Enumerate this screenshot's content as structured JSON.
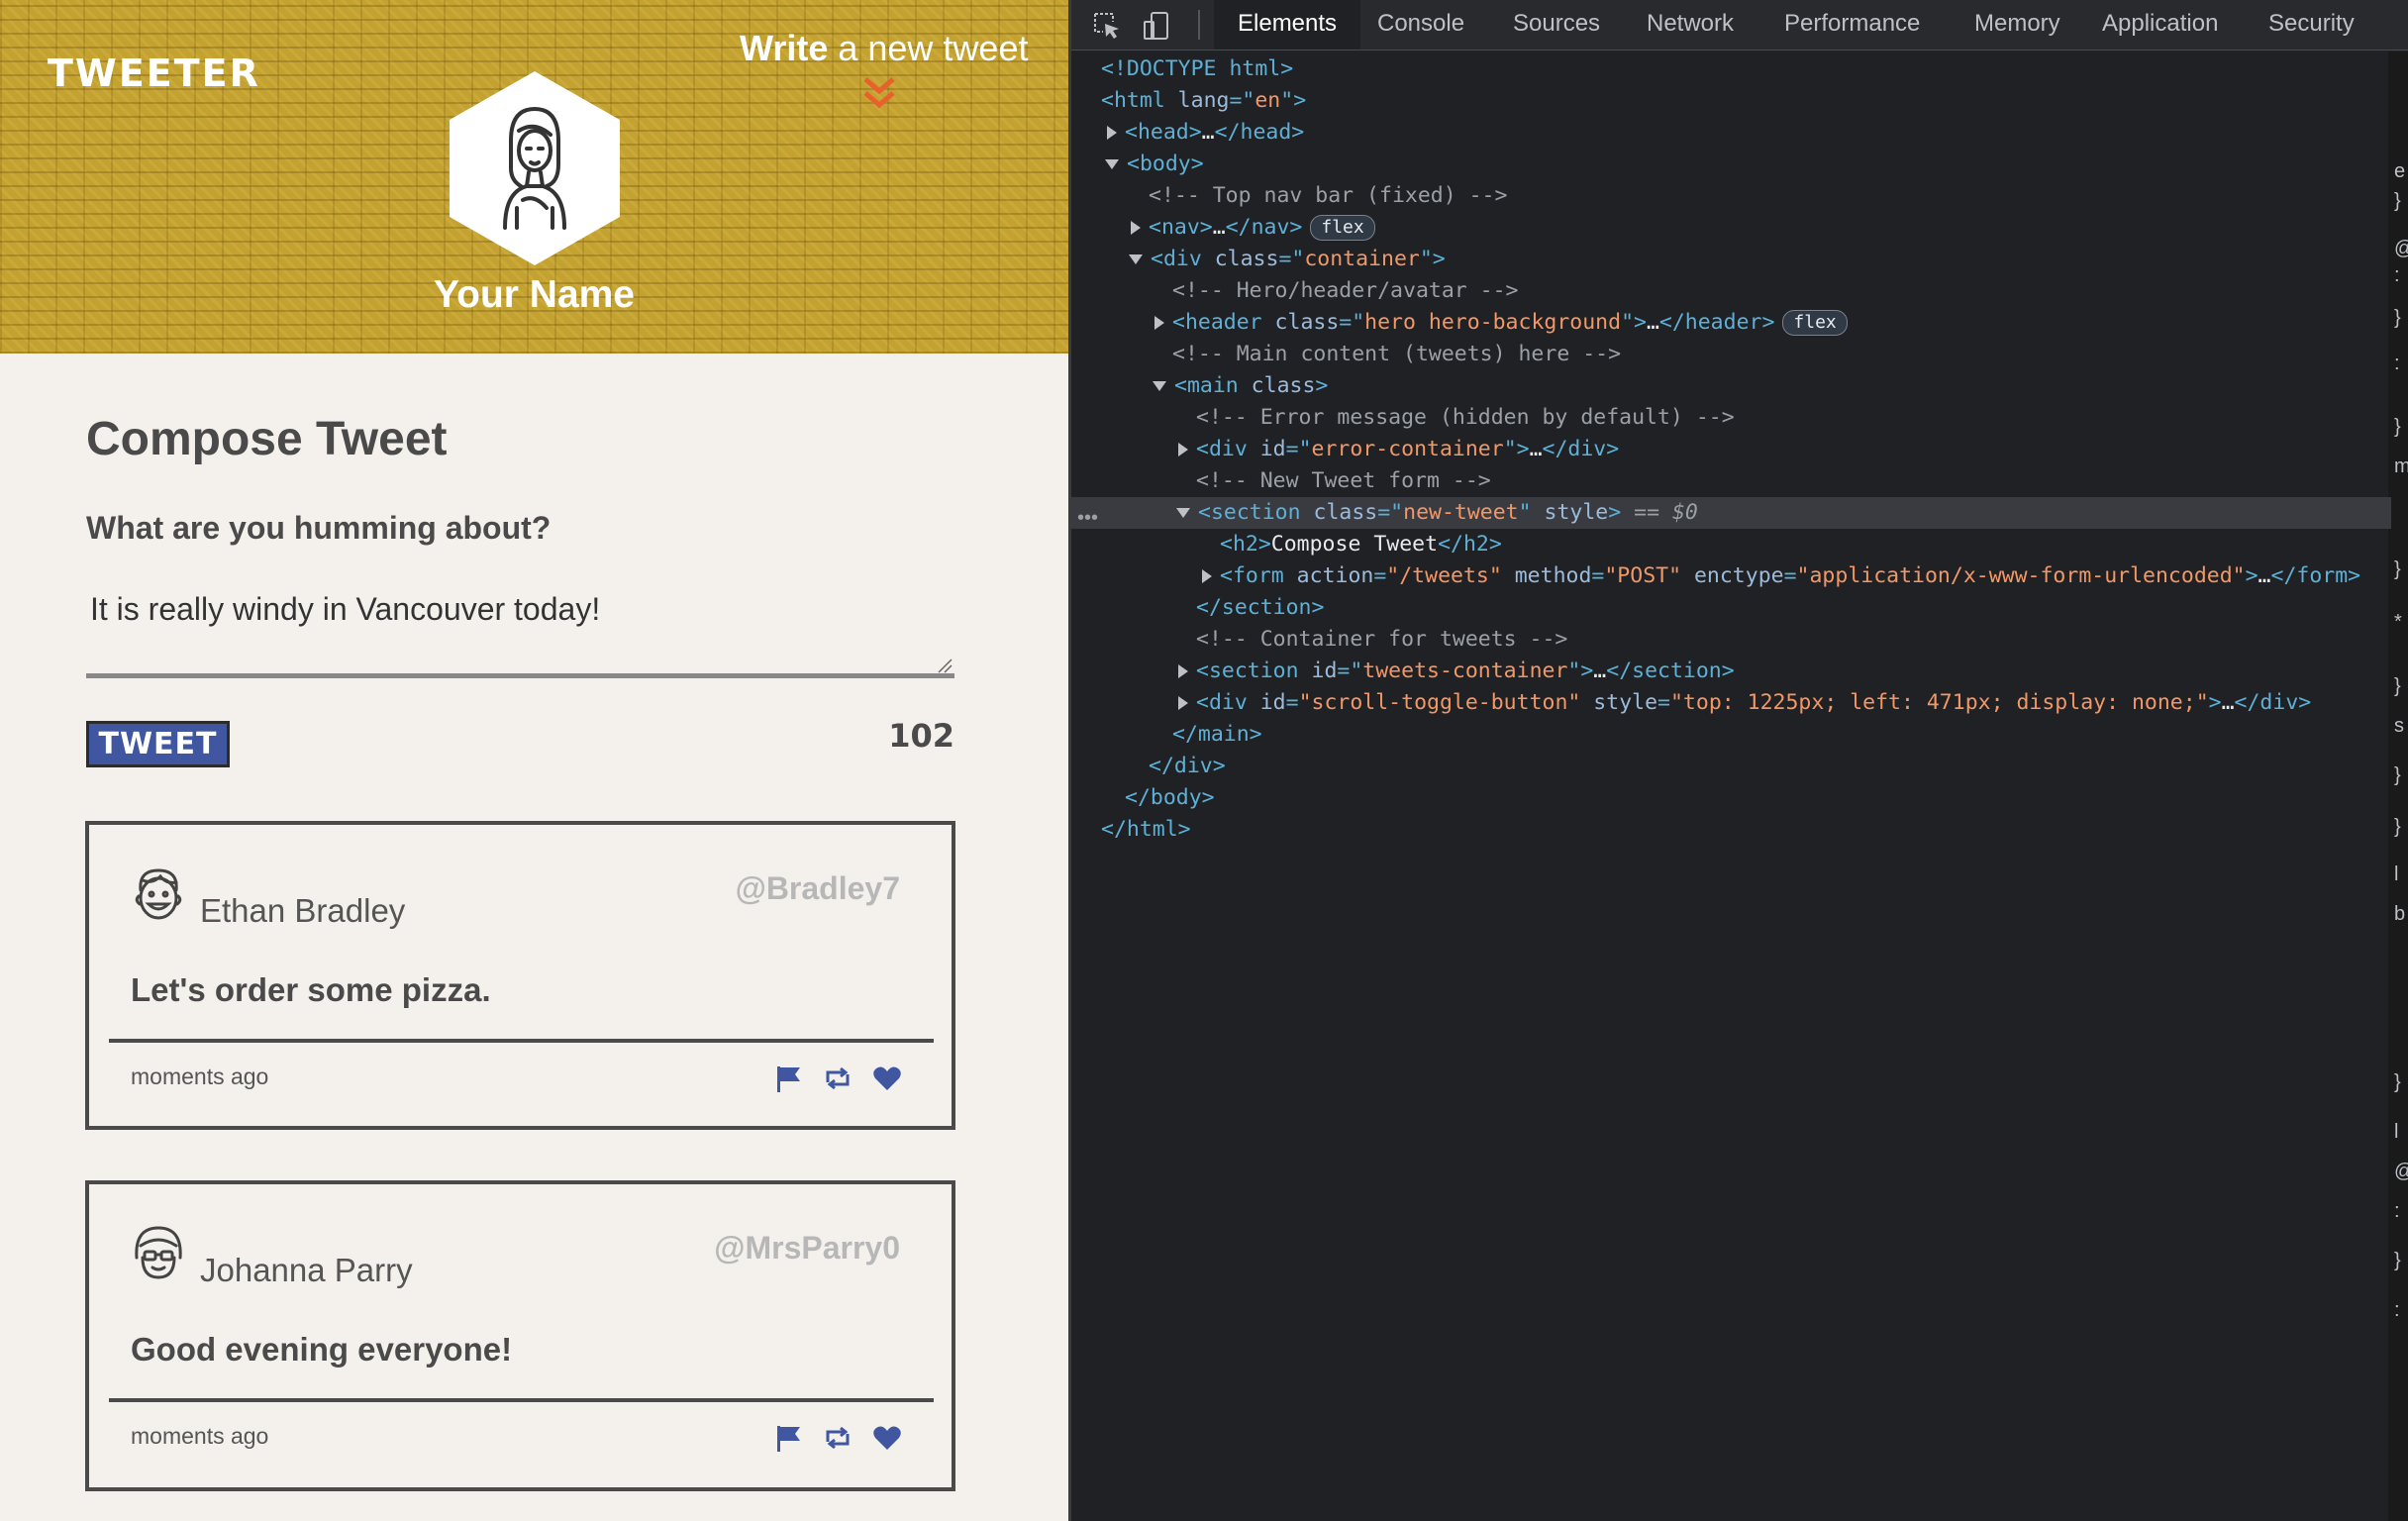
{
  "app": {
    "brand": "TWEETER",
    "write_prefix": "Write",
    "write_rest": " a new tweet",
    "hero_name": "Your Name",
    "compose": {
      "title": "Compose Tweet",
      "label": "What are you humming about?",
      "text": "It is really windy in Vancouver today!",
      "button": "TWEET",
      "counter": "102"
    },
    "tweets": [
      {
        "name": "Ethan Bradley",
        "handle": "@Bradley7",
        "content": "Let's order some pizza.",
        "time": "moments ago"
      },
      {
        "name": "Johanna Parry",
        "handle": "@MrsParry0",
        "content": "Good evening everyone!",
        "time": "moments ago"
      }
    ],
    "colors": {
      "hero": "#c4a231",
      "button": "#4056a1",
      "action_icons": "#4056a1",
      "arrow": "#e8602c"
    }
  },
  "devtools": {
    "tabs": [
      "Elements",
      "Console",
      "Sources",
      "Network",
      "Performance",
      "Memory",
      "Application",
      "Security"
    ],
    "active_tab": "Elements",
    "right_strip": [
      "e",
      "}",
      "@",
      ":",
      "}",
      ":",
      "}",
      "m",
      "}",
      "*",
      "}",
      "s",
      "}",
      "}",
      "l",
      "b",
      "}",
      "l",
      "@",
      ":",
      "}",
      ":"
    ],
    "dom": {
      "l0": {
        "a": "<!DOCTYPE html>"
      },
      "l1": {
        "a": "<html",
        "b": " lang",
        "c": "=\"",
        "d": "en",
        "e": "\">"
      },
      "l2": {
        "a": "<head>",
        "b": "…",
        "c": "</head>"
      },
      "l3": {
        "a": "<body>"
      },
      "l4": {
        "a": "<!-- Top nav bar (fixed) -->"
      },
      "l5": {
        "a": "<nav>",
        "b": "…",
        "c": "</nav>",
        "badge": "flex"
      },
      "l6": {
        "a": "<div",
        "b": " class",
        "c": "=\"",
        "d": "container",
        "e": "\">"
      },
      "l7": {
        "a": "<!-- Hero/header/avatar -->"
      },
      "l8": {
        "a": "<header",
        "b": " class",
        "c": "=\"",
        "d": "hero hero-background",
        "e": "\">",
        "f": "…",
        "g": "</header>",
        "badge": "flex"
      },
      "l9": {
        "a": "<!-- Main content (tweets) here -->"
      },
      "l10": {
        "a": "<main",
        "b": " class",
        "c": ">"
      },
      "l11": {
        "a": "<!-- Error message (hidden by default) -->"
      },
      "l12": {
        "a": "<div",
        "b": " id",
        "c": "=\"",
        "d": "error-container",
        "e": "\">",
        "f": "…",
        "g": "</div>"
      },
      "l13": {
        "a": "<!-- New Tweet form -->"
      },
      "l14": {
        "a": "<section",
        "b": " class",
        "c": "=\"",
        "d": "new-tweet",
        "e": "\"",
        "f": " style",
        "g": ">",
        "h": " == $0"
      },
      "l15": {
        "a": "<h2>",
        "b": "Compose Tweet",
        "c": "</h2>"
      },
      "l16": {
        "a": "<form",
        "b1": " action",
        "v1": "\"/tweets\"",
        "b2": " method",
        "v2": "\"POST\"",
        "b3": " enctype",
        "v3": "\"application/x-www-form-urlencoded\"",
        "e": ">",
        "f": "…",
        "g": "</form>"
      },
      "l17": {
        "a": "</section>"
      },
      "l18": {
        "a": "<!-- Container for tweets -->"
      },
      "l19": {
        "a": "<section",
        "b": " id",
        "c": "=\"",
        "d": "tweets-container",
        "e": "\">",
        "f": "…",
        "g": "</section>"
      },
      "l20": {
        "a": "<div",
        "b1": " id",
        "v1": "\"scroll-toggle-button\"",
        "b2": " style",
        "v2": "\"top: 1225px; left: 471px; display: none;\"",
        "e": ">",
        "f": "…",
        "g": "</div>"
      },
      "l21": {
        "a": "</main>"
      },
      "l22": {
        "a": "</div>"
      },
      "l23": {
        "a": "</body>"
      },
      "l24": {
        "a": "</html>"
      }
    }
  }
}
